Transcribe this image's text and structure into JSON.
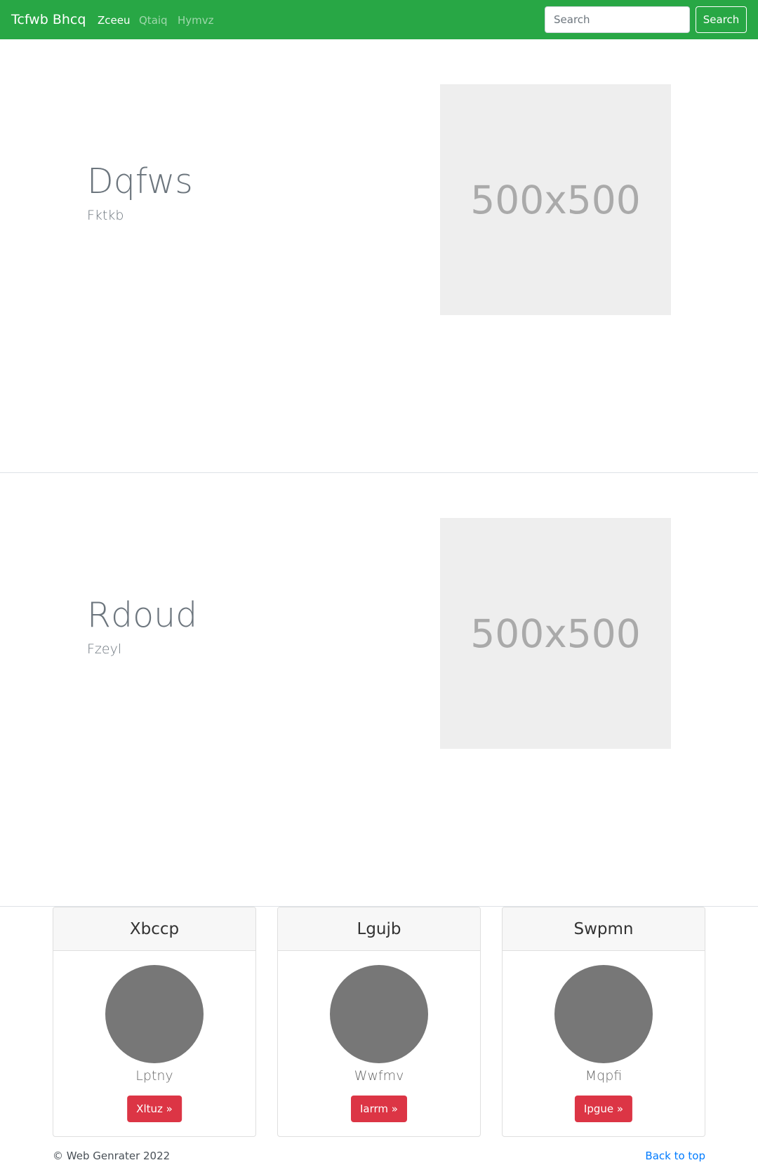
{
  "navbar": {
    "brand": "Tcfwb Bhcq",
    "links": [
      "Zceeu",
      "Qtaiq",
      "Hymvz"
    ],
    "search_placeholder": "Search",
    "search_button": "Search"
  },
  "features": [
    {
      "title": "Dqfws",
      "subtitle": "Fktkb",
      "image_label": "500x500"
    },
    {
      "title": "Rdoud",
      "subtitle": "Fzeyl",
      "image_label": "500x500"
    }
  ],
  "cards": [
    {
      "header": "Xbccp",
      "text": "Lptny",
      "button": "Xltuz »"
    },
    {
      "header": "Lgujb",
      "text": "Wwfmv",
      "button": "Iarrm »"
    },
    {
      "header": "Swpmn",
      "text": "Mqpfi",
      "button": "Ipgue »"
    }
  ],
  "footer": {
    "copyright": "© Web Genrater 2022",
    "back_to_top": "Back to top"
  },
  "colors": {
    "navbar_bg": "#28a745",
    "card_button_bg": "#dc3545",
    "link": "#007bff"
  }
}
